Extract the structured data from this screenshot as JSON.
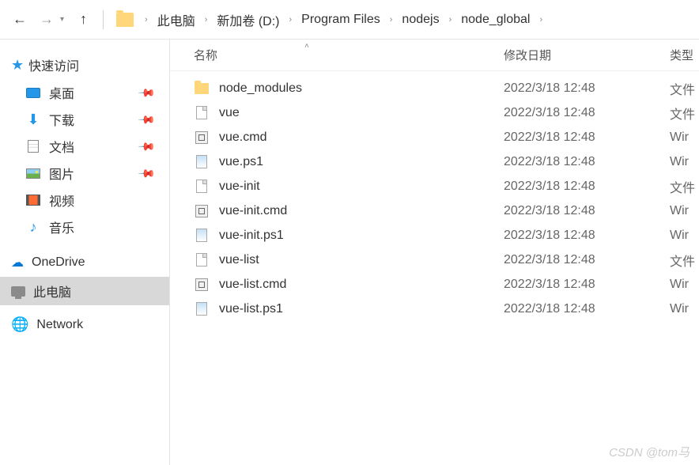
{
  "breadcrumb": [
    "此电脑",
    "新加卷 (D:)",
    "Program Files",
    "nodejs",
    "node_global"
  ],
  "sidebar": {
    "quick_access": "快速访问",
    "items": [
      {
        "label": "桌面",
        "icon": "desktop"
      },
      {
        "label": "下载",
        "icon": "download"
      },
      {
        "label": "文档",
        "icon": "docs"
      },
      {
        "label": "图片",
        "icon": "pics"
      },
      {
        "label": "视频",
        "icon": "video"
      },
      {
        "label": "音乐",
        "icon": "music"
      }
    ],
    "onedrive": "OneDrive",
    "this_pc": "此电脑",
    "network": "Network"
  },
  "columns": {
    "name": "名称",
    "date": "修改日期",
    "type": "类型"
  },
  "files": [
    {
      "name": "node_modules",
      "date": "2022/3/18 12:48",
      "type": "文件",
      "icon": "folder"
    },
    {
      "name": "vue",
      "date": "2022/3/18 12:48",
      "type": "文件",
      "icon": "file"
    },
    {
      "name": "vue.cmd",
      "date": "2022/3/18 12:48",
      "type": "Wir",
      "icon": "cmd"
    },
    {
      "name": "vue.ps1",
      "date": "2022/3/18 12:48",
      "type": "Wir",
      "icon": "ps1"
    },
    {
      "name": "vue-init",
      "date": "2022/3/18 12:48",
      "type": "文件",
      "icon": "file"
    },
    {
      "name": "vue-init.cmd",
      "date": "2022/3/18 12:48",
      "type": "Wir",
      "icon": "cmd"
    },
    {
      "name": "vue-init.ps1",
      "date": "2022/3/18 12:48",
      "type": "Wir",
      "icon": "ps1"
    },
    {
      "name": "vue-list",
      "date": "2022/3/18 12:48",
      "type": "文件",
      "icon": "file"
    },
    {
      "name": "vue-list.cmd",
      "date": "2022/3/18 12:48",
      "type": "Wir",
      "icon": "cmd"
    },
    {
      "name": "vue-list.ps1",
      "date": "2022/3/18 12:48",
      "type": "Wir",
      "icon": "ps1"
    }
  ],
  "watermark": "CSDN @tom马"
}
